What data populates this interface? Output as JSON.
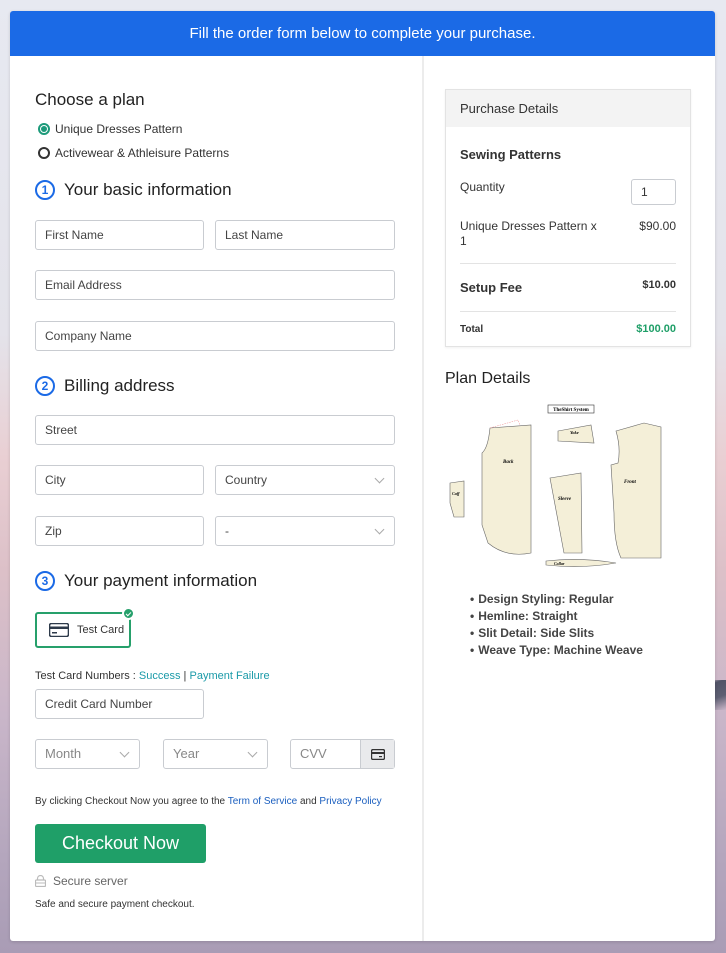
{
  "banner": {
    "text": "Fill the order form below to complete your purchase."
  },
  "plan": {
    "title": "Choose a plan",
    "options": [
      {
        "label": "Unique Dresses Pattern",
        "selected": true
      },
      {
        "label": "Activewear & Athleisure Patterns",
        "selected": false
      }
    ]
  },
  "basic_info": {
    "number": "1",
    "title": "Your basic information",
    "first_name_placeholder": "First Name",
    "last_name_placeholder": "Last Name",
    "email_placeholder": "Email Address",
    "company_placeholder": "Company Name"
  },
  "billing": {
    "number": "2",
    "title": "Billing address",
    "street_placeholder": "Street",
    "city_placeholder": "City",
    "country_placeholder": "Country",
    "zip_placeholder": "Zip",
    "state_value": "-"
  },
  "payment": {
    "number": "3",
    "title": "Your payment information",
    "method_label": "Test Card",
    "test_numbers_label": "Test Card Numbers : ",
    "success_link": "Success",
    "separator": " | ",
    "failure_link": "Payment Failure",
    "card_number_placeholder": "Credit Card Number",
    "month_placeholder": "Month",
    "year_placeholder": "Year",
    "cvv_placeholder": "CVV"
  },
  "terms": {
    "prefix": "By clicking Checkout Now you agree to the ",
    "tos_link": "Term of Service",
    "and": " and ",
    "privacy_link": "Privacy Policy"
  },
  "checkout": {
    "button_label": "Checkout Now",
    "secure_label": "Secure server",
    "safe_note": "Safe and secure payment checkout."
  },
  "purchase": {
    "header": "Purchase Details",
    "product_group": "Sewing Patterns",
    "quantity_label": "Quantity",
    "quantity_value": "1",
    "line_item": "Unique Dresses Pattern x 1",
    "line_price": "$90.00",
    "setup_fee_label": "Setup Fee",
    "setup_fee_value": "$10.00",
    "total_label": "Total",
    "total_value": "$100.00",
    "total_color": "#1f9f68"
  },
  "plan_details": {
    "title": "Plan Details",
    "image_caption": "TheShirt System",
    "pattern_pieces": [
      "Back",
      "Yoke",
      "Front",
      "Cuff",
      "Sleeve",
      "Collar"
    ],
    "features": [
      "Design Styling: Regular",
      "Hemline: Straight",
      "Slit Detail: Side Slits",
      "Weave Type: Machine Weave"
    ]
  },
  "colors": {
    "banner": "#1b6ae6",
    "accent_green": "#1f9f68",
    "link_teal": "#1a9aa8",
    "link_blue": "#1b5fbf"
  }
}
